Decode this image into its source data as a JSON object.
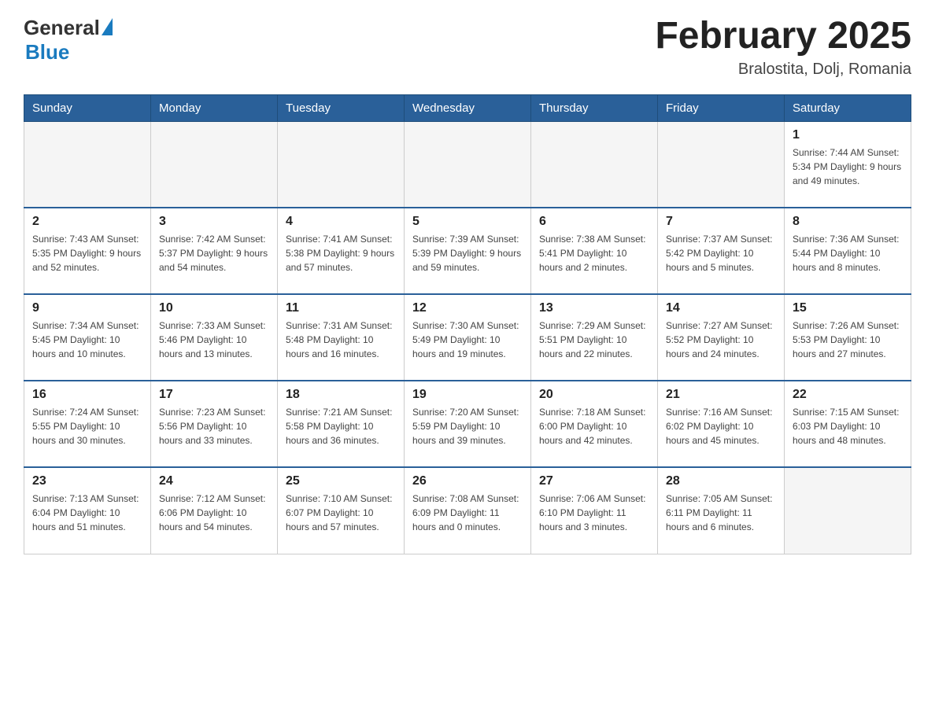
{
  "header": {
    "logo_general": "General",
    "logo_blue": "Blue",
    "title": "February 2025",
    "subtitle": "Bralostita, Dolj, Romania"
  },
  "days_of_week": [
    "Sunday",
    "Monday",
    "Tuesday",
    "Wednesday",
    "Thursday",
    "Friday",
    "Saturday"
  ],
  "weeks": [
    [
      {
        "day": "",
        "info": "",
        "empty": true
      },
      {
        "day": "",
        "info": "",
        "empty": true
      },
      {
        "day": "",
        "info": "",
        "empty": true
      },
      {
        "day": "",
        "info": "",
        "empty": true
      },
      {
        "day": "",
        "info": "",
        "empty": true
      },
      {
        "day": "",
        "info": "",
        "empty": true
      },
      {
        "day": "1",
        "info": "Sunrise: 7:44 AM\nSunset: 5:34 PM\nDaylight: 9 hours and 49 minutes.",
        "empty": false
      }
    ],
    [
      {
        "day": "2",
        "info": "Sunrise: 7:43 AM\nSunset: 5:35 PM\nDaylight: 9 hours and 52 minutes.",
        "empty": false
      },
      {
        "day": "3",
        "info": "Sunrise: 7:42 AM\nSunset: 5:37 PM\nDaylight: 9 hours and 54 minutes.",
        "empty": false
      },
      {
        "day": "4",
        "info": "Sunrise: 7:41 AM\nSunset: 5:38 PM\nDaylight: 9 hours and 57 minutes.",
        "empty": false
      },
      {
        "day": "5",
        "info": "Sunrise: 7:39 AM\nSunset: 5:39 PM\nDaylight: 9 hours and 59 minutes.",
        "empty": false
      },
      {
        "day": "6",
        "info": "Sunrise: 7:38 AM\nSunset: 5:41 PM\nDaylight: 10 hours and 2 minutes.",
        "empty": false
      },
      {
        "day": "7",
        "info": "Sunrise: 7:37 AM\nSunset: 5:42 PM\nDaylight: 10 hours and 5 minutes.",
        "empty": false
      },
      {
        "day": "8",
        "info": "Sunrise: 7:36 AM\nSunset: 5:44 PM\nDaylight: 10 hours and 8 minutes.",
        "empty": false
      }
    ],
    [
      {
        "day": "9",
        "info": "Sunrise: 7:34 AM\nSunset: 5:45 PM\nDaylight: 10 hours and 10 minutes.",
        "empty": false
      },
      {
        "day": "10",
        "info": "Sunrise: 7:33 AM\nSunset: 5:46 PM\nDaylight: 10 hours and 13 minutes.",
        "empty": false
      },
      {
        "day": "11",
        "info": "Sunrise: 7:31 AM\nSunset: 5:48 PM\nDaylight: 10 hours and 16 minutes.",
        "empty": false
      },
      {
        "day": "12",
        "info": "Sunrise: 7:30 AM\nSunset: 5:49 PM\nDaylight: 10 hours and 19 minutes.",
        "empty": false
      },
      {
        "day": "13",
        "info": "Sunrise: 7:29 AM\nSunset: 5:51 PM\nDaylight: 10 hours and 22 minutes.",
        "empty": false
      },
      {
        "day": "14",
        "info": "Sunrise: 7:27 AM\nSunset: 5:52 PM\nDaylight: 10 hours and 24 minutes.",
        "empty": false
      },
      {
        "day": "15",
        "info": "Sunrise: 7:26 AM\nSunset: 5:53 PM\nDaylight: 10 hours and 27 minutes.",
        "empty": false
      }
    ],
    [
      {
        "day": "16",
        "info": "Sunrise: 7:24 AM\nSunset: 5:55 PM\nDaylight: 10 hours and 30 minutes.",
        "empty": false
      },
      {
        "day": "17",
        "info": "Sunrise: 7:23 AM\nSunset: 5:56 PM\nDaylight: 10 hours and 33 minutes.",
        "empty": false
      },
      {
        "day": "18",
        "info": "Sunrise: 7:21 AM\nSunset: 5:58 PM\nDaylight: 10 hours and 36 minutes.",
        "empty": false
      },
      {
        "day": "19",
        "info": "Sunrise: 7:20 AM\nSunset: 5:59 PM\nDaylight: 10 hours and 39 minutes.",
        "empty": false
      },
      {
        "day": "20",
        "info": "Sunrise: 7:18 AM\nSunset: 6:00 PM\nDaylight: 10 hours and 42 minutes.",
        "empty": false
      },
      {
        "day": "21",
        "info": "Sunrise: 7:16 AM\nSunset: 6:02 PM\nDaylight: 10 hours and 45 minutes.",
        "empty": false
      },
      {
        "day": "22",
        "info": "Sunrise: 7:15 AM\nSunset: 6:03 PM\nDaylight: 10 hours and 48 minutes.",
        "empty": false
      }
    ],
    [
      {
        "day": "23",
        "info": "Sunrise: 7:13 AM\nSunset: 6:04 PM\nDaylight: 10 hours and 51 minutes.",
        "empty": false
      },
      {
        "day": "24",
        "info": "Sunrise: 7:12 AM\nSunset: 6:06 PM\nDaylight: 10 hours and 54 minutes.",
        "empty": false
      },
      {
        "day": "25",
        "info": "Sunrise: 7:10 AM\nSunset: 6:07 PM\nDaylight: 10 hours and 57 minutes.",
        "empty": false
      },
      {
        "day": "26",
        "info": "Sunrise: 7:08 AM\nSunset: 6:09 PM\nDaylight: 11 hours and 0 minutes.",
        "empty": false
      },
      {
        "day": "27",
        "info": "Sunrise: 7:06 AM\nSunset: 6:10 PM\nDaylight: 11 hours and 3 minutes.",
        "empty": false
      },
      {
        "day": "28",
        "info": "Sunrise: 7:05 AM\nSunset: 6:11 PM\nDaylight: 11 hours and 6 minutes.",
        "empty": false
      },
      {
        "day": "",
        "info": "",
        "empty": true
      }
    ]
  ]
}
